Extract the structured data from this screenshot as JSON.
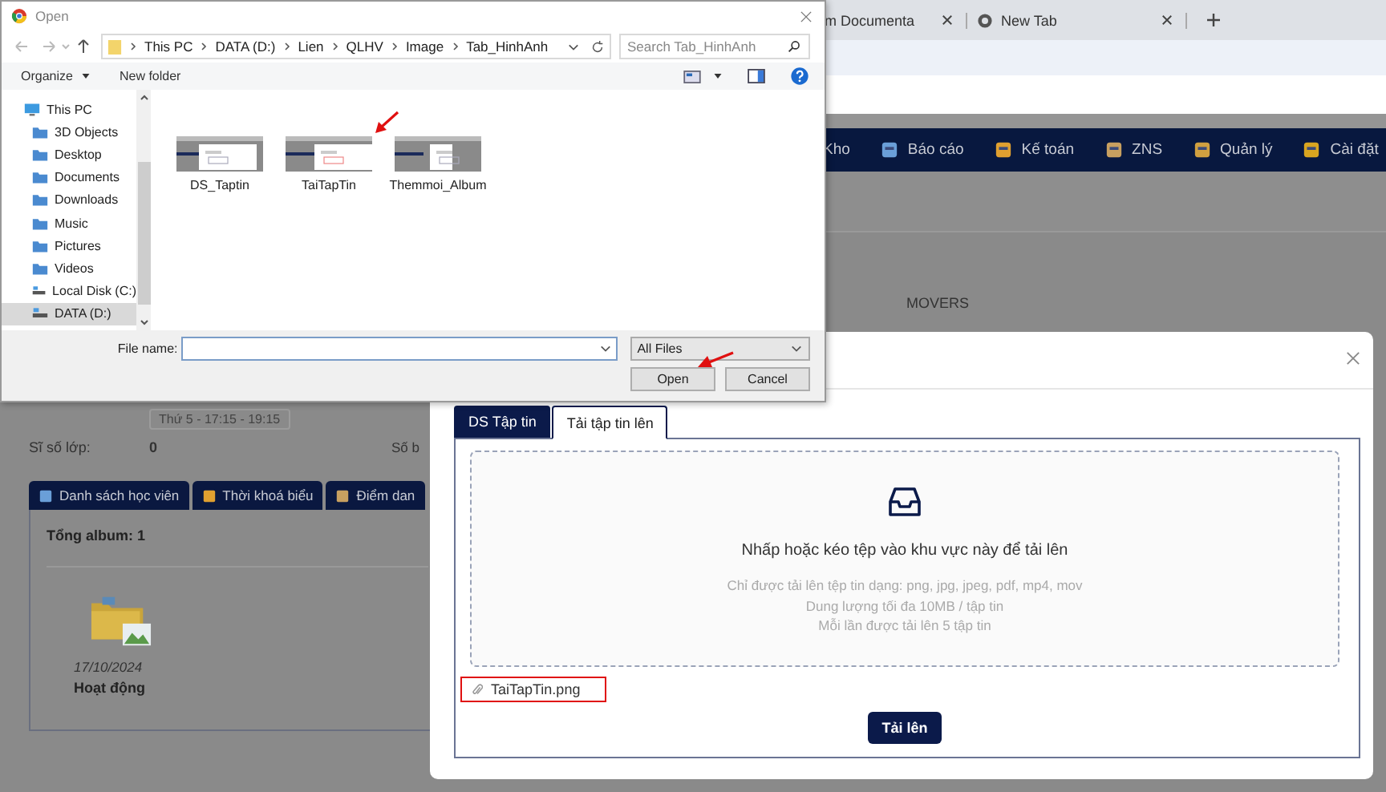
{
  "browser": {
    "tabs": [
      {
        "label": "m Documenta"
      },
      {
        "label": "New Tab"
      }
    ]
  },
  "nav": {
    "items": [
      {
        "label": "Kho",
        "icon": false
      },
      {
        "label": "Báo cáo",
        "icon": true
      },
      {
        "label": "Kế toán",
        "icon": true
      },
      {
        "label": "ZNS",
        "icon": true
      },
      {
        "label": "Quản lý",
        "icon": true
      },
      {
        "label": "Cài đặt",
        "icon": true
      }
    ]
  },
  "class_info": {
    "course": "MOVERS",
    "schedule": "Thứ 5 - 17:15 - 19:15",
    "size_label": "Sĩ số lớp:",
    "size_value": "0",
    "label_3": "Số b"
  },
  "section_tabs": [
    {
      "label": "Danh sách học viên"
    },
    {
      "label": "Thời khoá biểu"
    },
    {
      "label": "Điểm dan"
    }
  ],
  "album": {
    "total": "Tổng album: 1",
    "items": [
      {
        "date": "17/10/2024",
        "name": "Hoạt động"
      }
    ]
  },
  "modal": {
    "tabs": [
      {
        "label": "DS Tập tin",
        "selected": false
      },
      {
        "label": "Tải tập tin lên",
        "selected": true
      }
    ],
    "dropzone": {
      "title": "Nhấp hoặc kéo tệp vào khu vực này để tải lên",
      "hints": [
        "Chỉ được tải lên tệp tin dạng: png, jpg, jpeg, pdf, mp4, mov",
        "Dung lượng tối đa 10MB / tập tin",
        "Mỗi lần được tải lên 5 tập tin"
      ]
    },
    "files": [
      {
        "name": "TaiTapTin.png",
        "highlighted": true
      }
    ],
    "submit": "Tải lên"
  },
  "file_dialog": {
    "title": "Open",
    "path": [
      "This PC",
      "DATA (D:)",
      "Lien",
      "QLHV",
      "Image",
      "Tab_HinhAnh"
    ],
    "search": {
      "placeholder": "Search Tab_HinhAnh"
    },
    "toolbar": [
      "Organize",
      "New folder"
    ],
    "nav": [
      {
        "label": "This PC",
        "kind": "computer",
        "selected": false,
        "children": [
          {
            "label": "3D Objects",
            "kind": "folder",
            "selected": false
          },
          {
            "label": "Desktop",
            "kind": "folder",
            "selected": false
          },
          {
            "label": "Documents",
            "kind": "folder",
            "selected": false
          },
          {
            "label": "Downloads",
            "kind": "folder",
            "selected": false
          },
          {
            "label": "Music",
            "kind": "folder",
            "selected": false
          },
          {
            "label": "Pictures",
            "kind": "folder",
            "selected": false
          },
          {
            "label": "Videos",
            "kind": "folder",
            "selected": false
          },
          {
            "label": "Local Disk (C:)",
            "kind": "drive",
            "selected": false
          },
          {
            "label": "DATA (D:)",
            "kind": "drive",
            "selected": true
          }
        ]
      }
    ],
    "files": [
      {
        "name": "DS_Taptin",
        "pointed": false
      },
      {
        "name": "TaiTapTin",
        "pointed": true
      },
      {
        "name": "Themmoi_Album",
        "pointed": false
      }
    ],
    "file_name_label": "File name:",
    "file_type": "All Files",
    "buttons": [
      {
        "label": "Open",
        "pointed": true
      },
      {
        "label": "Cancel",
        "pointed": false
      }
    ]
  }
}
